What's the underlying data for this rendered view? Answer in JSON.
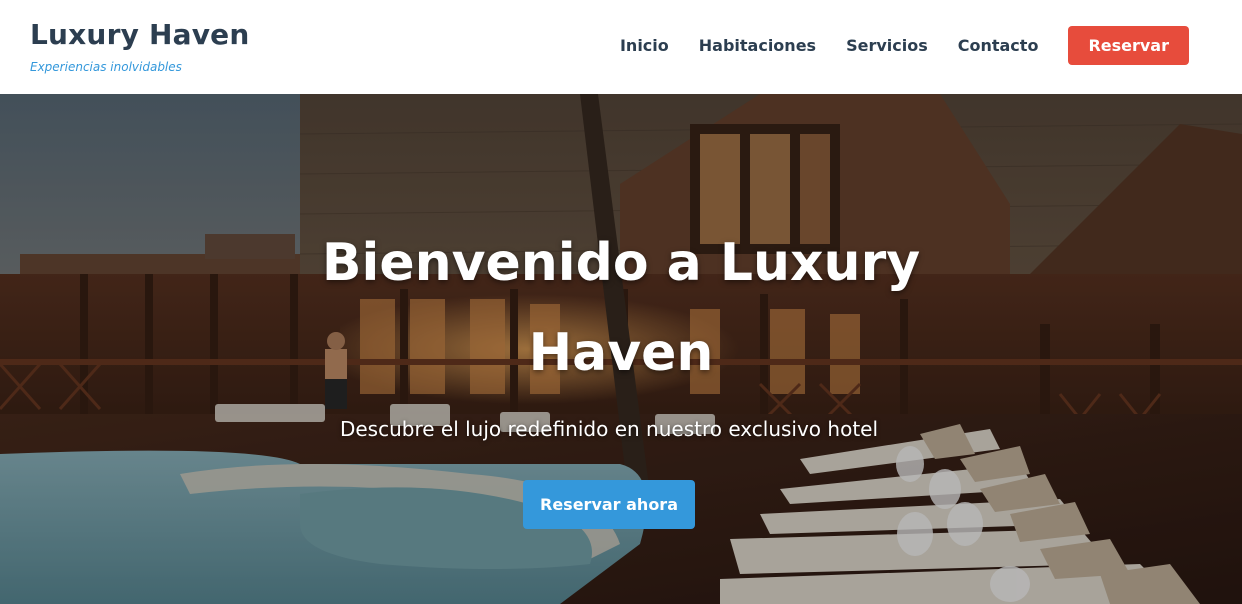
{
  "header": {
    "brand_title": "Luxury Haven",
    "brand_tagline": "Experiencias inolvidables",
    "nav": [
      {
        "label": "Inicio"
      },
      {
        "label": "Habitaciones"
      },
      {
        "label": "Servicios"
      },
      {
        "label": "Contacto"
      }
    ],
    "cta_label": "Reservar"
  },
  "hero": {
    "title": "Bienvenido a Luxury Haven",
    "subtitle": "Descubre el lujo redefinido en nuestro exclusivo hotel",
    "button_label": "Reservar ahora",
    "background_image": "resort-pool-villa-photo"
  },
  "colors": {
    "brand_dark": "#2c3e50",
    "accent_blue": "#3498db",
    "accent_red": "#e74c3c"
  }
}
